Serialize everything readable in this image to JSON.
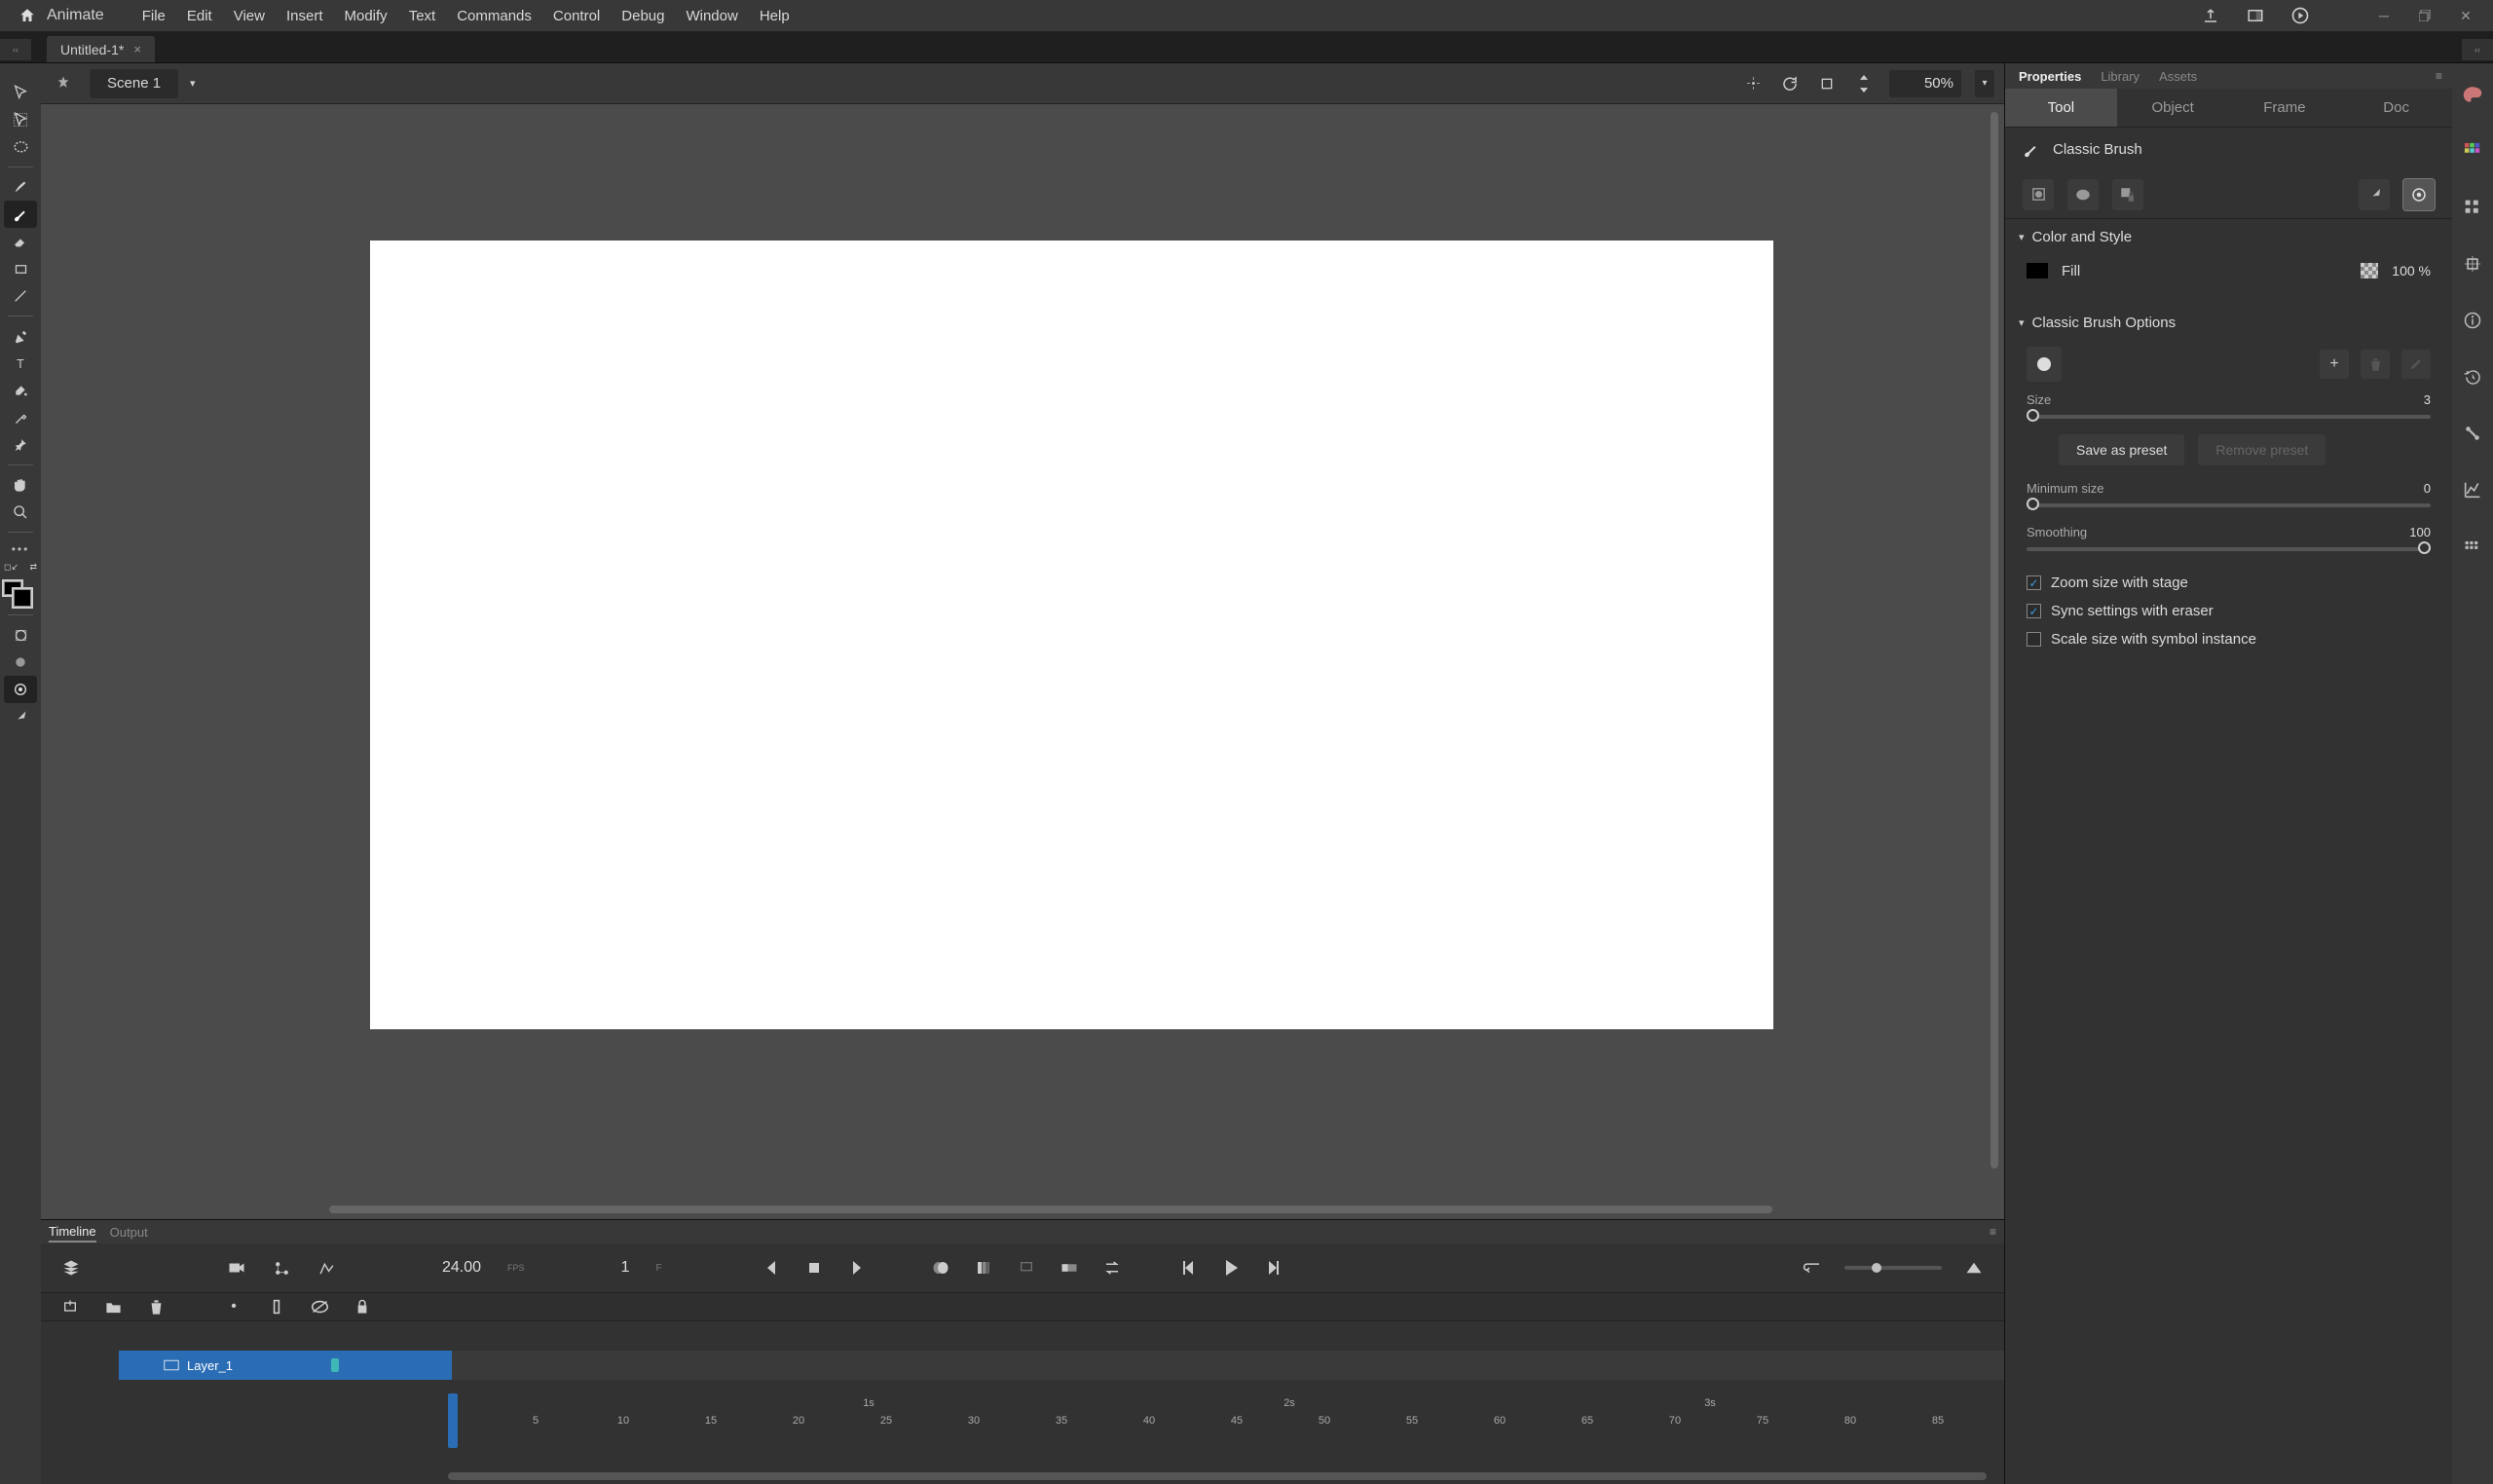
{
  "app": {
    "name": "Animate"
  },
  "menu": [
    "File",
    "Edit",
    "View",
    "Insert",
    "Modify",
    "Text",
    "Commands",
    "Control",
    "Debug",
    "Window",
    "Help"
  ],
  "doc_tab": {
    "title": "Untitled-1*"
  },
  "scene": {
    "name": "Scene 1",
    "zoom": "50%"
  },
  "timeline": {
    "tabs": [
      "Timeline",
      "Output"
    ],
    "fps": "24.00",
    "fps_label": "FPS",
    "current_frame": "1",
    "frame_label": "F",
    "layer_name": "Layer_1",
    "ticks": [
      5,
      10,
      15,
      20,
      25,
      30,
      35,
      40,
      45,
      50,
      55,
      60,
      65,
      70,
      75,
      80,
      85
    ],
    "sec_labels": [
      {
        "t": "1s",
        "f": 24
      },
      {
        "t": "2s",
        "f": 48
      },
      {
        "t": "3s",
        "f": 72
      }
    ]
  },
  "props": {
    "panel_tabs": [
      "Properties",
      "Library",
      "Assets"
    ],
    "subtabs": [
      "Tool",
      "Object",
      "Frame",
      "Doc"
    ],
    "tool_name": "Classic Brush",
    "section_color": "Color and Style",
    "fill_label": "Fill",
    "fill_opacity": "100 %",
    "section_brush": "Classic Brush Options",
    "size_label": "Size",
    "size_val": "3",
    "save_preset": "Save as preset",
    "remove_preset": "Remove preset",
    "min_size_label": "Minimum size",
    "min_size_val": "0",
    "smoothing_label": "Smoothing",
    "smoothing_val": "100",
    "cb1": "Zoom size with stage",
    "cb2": "Sync settings with eraser",
    "cb3": "Scale size with symbol instance"
  }
}
